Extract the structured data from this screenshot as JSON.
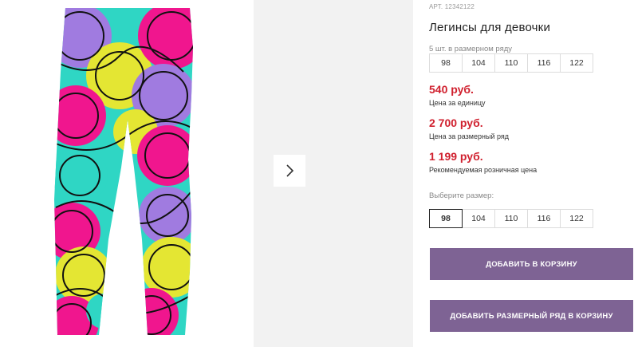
{
  "product": {
    "art_label": "АРТ.",
    "art_value": "12342122",
    "title": "Легинсы для девочки",
    "image_icon": "leggings-product-image"
  },
  "gallery": {
    "next_icon": "chevron-right-icon"
  },
  "size_row": {
    "note": "5 шт. в размерном ряду",
    "sizes": [
      "98",
      "104",
      "110",
      "116",
      "122"
    ]
  },
  "prices": [
    {
      "amount": "540 руб.",
      "label": "Цена за единицу"
    },
    {
      "amount": "2 700 руб.",
      "label": "Цена за размерный ряд"
    },
    {
      "amount": "1 199 руб.",
      "label": "Рекомендуемая розничная цена"
    }
  ],
  "size_select": {
    "label": "Выберите размер:",
    "sizes": [
      "98",
      "104",
      "110",
      "116",
      "122"
    ],
    "selected": "98"
  },
  "actions": {
    "add_to_cart": "ДОБАВИТЬ В КОРЗИНУ",
    "add_row_to_cart": "ДОБАВИТЬ РАЗМЕРНЫЙ РЯД В КОРЗИНУ"
  },
  "colors": {
    "price": "#d0202e",
    "button": "#7e6394",
    "pattern_cyan": "#2fd6c4",
    "pattern_pink": "#f0168e",
    "pattern_yellow": "#e4e633",
    "pattern_purple": "#a07be0"
  }
}
